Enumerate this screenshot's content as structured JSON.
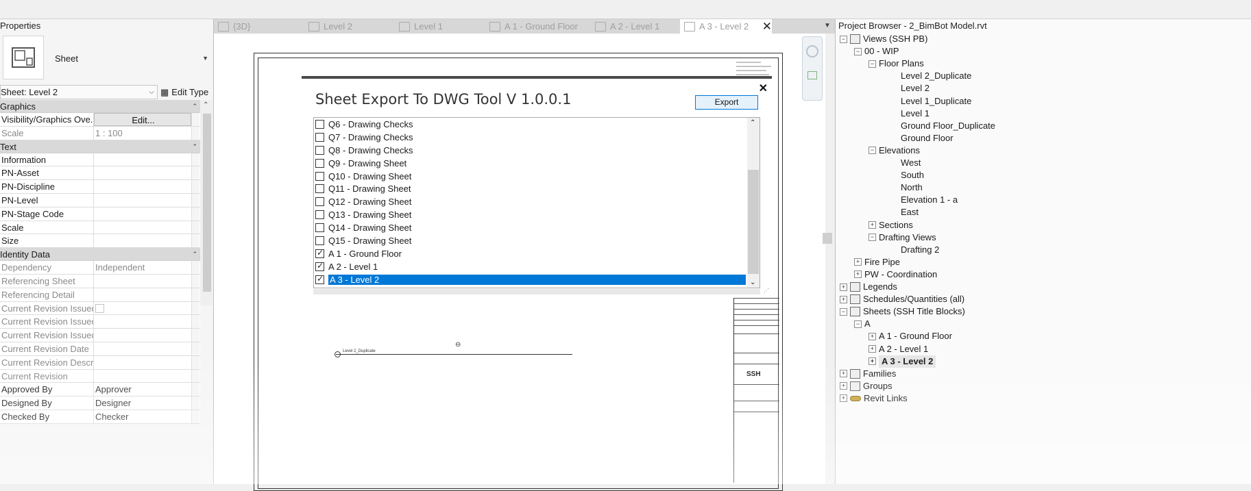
{
  "properties": {
    "title": "Properties",
    "type_name": "Sheet",
    "instance_selector": "Sheet: Level 2",
    "edit_type": "Edit Type",
    "groups": [
      {
        "name": "Graphics",
        "rows": [
          {
            "key": "Visibility/Graphics Ove...",
            "value": "Edit...",
            "button": true
          },
          {
            "key": "Scale",
            "value": "1 : 100",
            "readonly": true
          }
        ]
      },
      {
        "name": "Text",
        "rows": [
          {
            "key": "Information",
            "value": ""
          },
          {
            "key": "PN-Asset",
            "value": ""
          },
          {
            "key": "PN-Discipline",
            "value": ""
          },
          {
            "key": "PN-Level",
            "value": ""
          },
          {
            "key": "PN-Stage Code",
            "value": ""
          },
          {
            "key": "Scale",
            "value": ""
          },
          {
            "key": "Size",
            "value": ""
          }
        ]
      },
      {
        "name": "Identity Data",
        "rows": [
          {
            "key": "Dependency",
            "value": "Independent",
            "readonly": true
          },
          {
            "key": "Referencing Sheet",
            "value": "",
            "readonly": true
          },
          {
            "key": "Referencing Detail",
            "value": "",
            "readonly": true
          },
          {
            "key": "Current Revision Issued",
            "value": "",
            "readonly": true,
            "checkbox": true
          },
          {
            "key": "Current Revision Issued...",
            "value": "",
            "readonly": true
          },
          {
            "key": "Current Revision Issued...",
            "value": "",
            "readonly": true
          },
          {
            "key": "Current Revision Date",
            "value": "",
            "readonly": true
          },
          {
            "key": "Current Revision Descri...",
            "value": "",
            "readonly": true
          },
          {
            "key": "Current Revision",
            "value": "",
            "readonly": true
          },
          {
            "key": "Approved By",
            "value": "Approver"
          },
          {
            "key": "Designed By",
            "value": "Designer"
          },
          {
            "key": "Checked By",
            "value": "Checker"
          }
        ]
      }
    ]
  },
  "tabs": [
    {
      "label": "{3D}"
    },
    {
      "label": "Level 2"
    },
    {
      "label": "Level 1"
    },
    {
      "label": "A 1 - Ground Floor"
    },
    {
      "label": "A 2 - Level 1"
    },
    {
      "label": "A 3 - Level 2",
      "active": true
    }
  ],
  "dialog": {
    "title": "Sheet Export To DWG Tool V 1.0.0.1",
    "export_label": "Export",
    "close_glyph": "✕",
    "items": [
      {
        "label": "Q6 - Drawing Checks",
        "checked": false
      },
      {
        "label": "Q7 - Drawing Checks",
        "checked": false
      },
      {
        "label": "Q8 - Drawing Checks",
        "checked": false
      },
      {
        "label": "Q9 - Drawing Sheet",
        "checked": false
      },
      {
        "label": "Q10 - Drawing Sheet",
        "checked": false
      },
      {
        "label": "Q11 - Drawing Sheet",
        "checked": false
      },
      {
        "label": "Q12 - Drawing Sheet",
        "checked": false
      },
      {
        "label": "Q13 - Drawing Sheet",
        "checked": false
      },
      {
        "label": "Q14 - Drawing Sheet",
        "checked": false
      },
      {
        "label": "Q15 - Drawing Sheet",
        "checked": false
      },
      {
        "label": "A 1 - Ground Floor",
        "checked": true
      },
      {
        "label": "A 2 - Level 1",
        "checked": true
      },
      {
        "label": "A 3 - Level 2",
        "checked": true,
        "selected": true
      }
    ]
  },
  "canvas": {
    "view_label": "Level 2_Duplicate",
    "titleblock_logo": "SSH"
  },
  "browser": {
    "title": "Project Browser - 2_BimBot Model.rvt",
    "nodes": [
      {
        "label": "Views (SSH PB)",
        "level": 0,
        "exp": "−",
        "icon": true
      },
      {
        "label": "00 - WIP",
        "level": 1,
        "exp": "−"
      },
      {
        "label": "Floor Plans",
        "level": 2,
        "exp": "−"
      },
      {
        "label": "Level 2_Duplicate",
        "level": 3
      },
      {
        "label": "Level 2",
        "level": 3
      },
      {
        "label": "Level 1_Duplicate",
        "level": 3
      },
      {
        "label": "Level 1",
        "level": 3
      },
      {
        "label": "Ground Floor_Duplicate",
        "level": 3
      },
      {
        "label": "Ground Floor",
        "level": 3
      },
      {
        "label": "Elevations",
        "level": 2,
        "exp": "−"
      },
      {
        "label": "West",
        "level": 3
      },
      {
        "label": "South",
        "level": 3
      },
      {
        "label": "North",
        "level": 3
      },
      {
        "label": "Elevation 1 - a",
        "level": 3
      },
      {
        "label": "East",
        "level": 3
      },
      {
        "label": "Sections",
        "level": 2,
        "exp": "+"
      },
      {
        "label": "Drafting Views",
        "level": 2,
        "exp": "−"
      },
      {
        "label": "Drafting 2",
        "level": 3
      },
      {
        "label": "Fire Pipe",
        "level": 1,
        "exp": "+"
      },
      {
        "label": "PW - Coordination",
        "level": 1,
        "exp": "+"
      },
      {
        "label": "Legends",
        "level": 0,
        "exp": "+",
        "icon": true
      },
      {
        "label": "Schedules/Quantities (all)",
        "level": 0,
        "exp": "+",
        "icon": true
      },
      {
        "label": "Sheets (SSH Title Blocks)",
        "level": 0,
        "exp": "−",
        "icon": true
      },
      {
        "label": "A",
        "level": 1,
        "exp": "−"
      },
      {
        "label": "A 1 - Ground Floor",
        "level": 2,
        "exp": "+"
      },
      {
        "label": "A 2 - Level 1",
        "level": 2,
        "exp": "+"
      },
      {
        "label": "A 3 - Level 2",
        "level": 2,
        "exp": "+",
        "bold": true
      },
      {
        "label": "Families",
        "level": 0,
        "exp": "+",
        "icon": true
      },
      {
        "label": "Groups",
        "level": 0,
        "exp": "+",
        "icon": true
      },
      {
        "label": "Revit Links",
        "level": 0,
        "exp": "+",
        "icon": true,
        "gold": true
      }
    ]
  }
}
